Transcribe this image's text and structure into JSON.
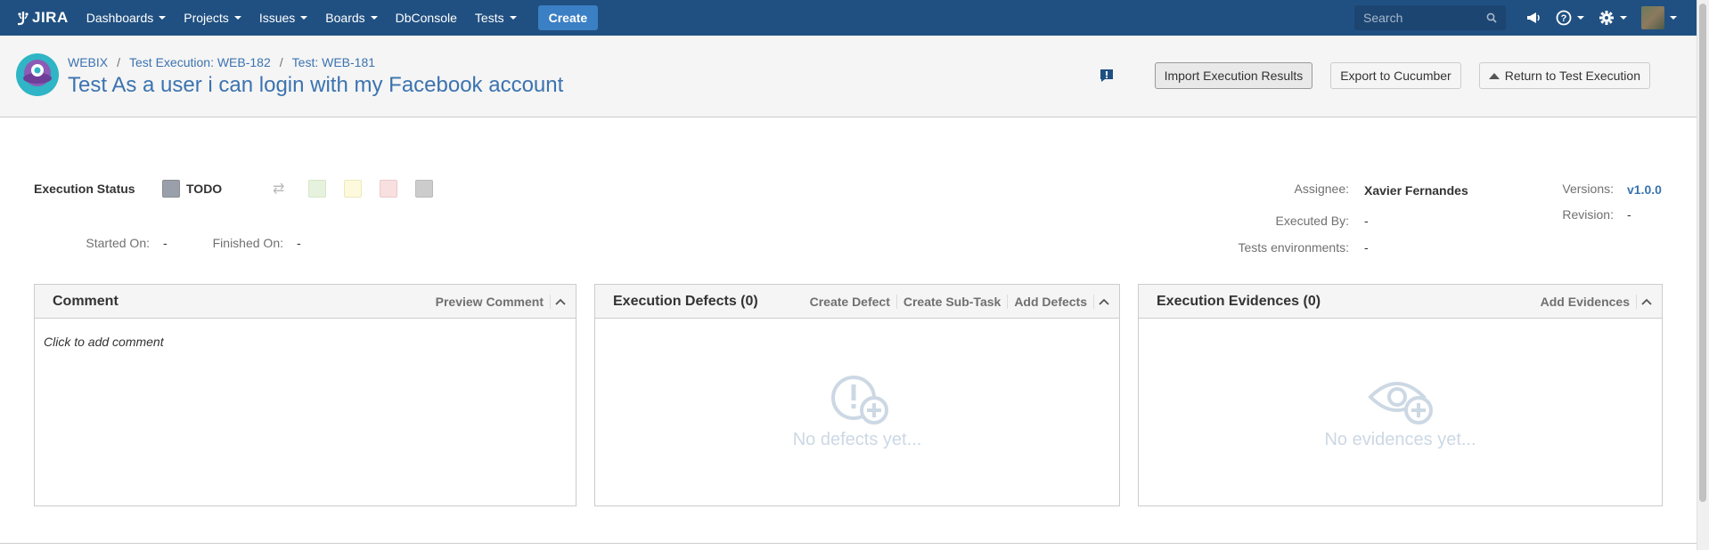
{
  "nav": {
    "logo_text": "JIRA",
    "items": [
      {
        "label": "Dashboards",
        "caret": true
      },
      {
        "label": "Projects",
        "caret": true
      },
      {
        "label": "Issues",
        "caret": true
      },
      {
        "label": "Boards",
        "caret": true
      },
      {
        "label": "DbConsole",
        "caret": false
      },
      {
        "label": "Tests",
        "caret": true
      }
    ],
    "create_label": "Create",
    "search_placeholder": "Search"
  },
  "header": {
    "breadcrumbs": [
      "WEBIX",
      "Test Execution: WEB-182",
      "Test: WEB-181"
    ],
    "title": "Test As a user i can login with my Facebook account",
    "import_label": "Import Execution Results",
    "export_label": "Export to Cucumber",
    "return_label": "Return to Test Execution"
  },
  "execution": {
    "status_label": "Execution Status",
    "status_value": "TODO",
    "status_color": "#99a0ab",
    "swatches": [
      "#e6f2dd",
      "#fcf9dc",
      "#f8e0e0",
      "#cccccc"
    ],
    "started_label": "Started On:",
    "started_value": "-",
    "finished_label": "Finished On:",
    "finished_value": "-",
    "assignee_label": "Assignee:",
    "assignee_value": "Xavier Fernandes",
    "executed_by_label": "Executed By:",
    "executed_by_value": "-",
    "environments_label": "Tests environments:",
    "environments_value": "-",
    "versions_label": "Versions:",
    "versions_value": "v1.0.0",
    "revision_label": "Revision:",
    "revision_value": "-"
  },
  "panels": {
    "comment": {
      "title": "Comment",
      "preview_label": "Preview Comment",
      "placeholder": "Click to add comment"
    },
    "defects": {
      "title": "Execution Defects (0)",
      "actions": [
        "Create Defect",
        "Create Sub-Task",
        "Add Defects"
      ],
      "empty_text": "No defects yet..."
    },
    "evidences": {
      "title": "Execution Evidences (0)",
      "actions": [
        "Add Evidences"
      ],
      "empty_text": "No evidences yet..."
    }
  }
}
